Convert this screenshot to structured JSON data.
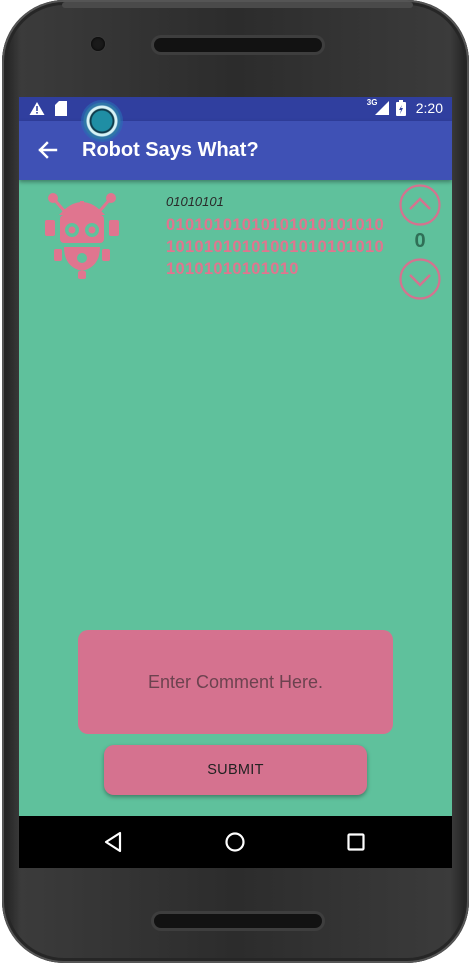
{
  "status_bar": {
    "network_type": "3G",
    "time": "2:20",
    "icons": [
      "warning-icon",
      "sd-card-icon",
      "signal-icon",
      "battery-icon"
    ]
  },
  "app_bar": {
    "title": "Robot Says What?",
    "back_icon": "arrow-left-icon"
  },
  "post": {
    "avatar_icon": "robot-icon",
    "author": "01010101",
    "body": "010101010101010101010101010101010100101010101010101010101010",
    "vote_up_icon": "chevron-up-circle-icon",
    "vote_count": "0",
    "vote_down_icon": "chevron-down-circle-icon"
  },
  "comment": {
    "placeholder": "Enter Comment Here.",
    "value": "",
    "submit_label": "SUBMIT"
  },
  "nav_bar": {
    "icons": [
      "nav-back-icon",
      "nav-home-icon",
      "nav-recents-icon"
    ]
  },
  "colors": {
    "status_bar": "#303f9f",
    "app_bar": "#3f51b5",
    "background": "#5fc19c",
    "accent_pink": "#d5728f",
    "vote_count": "#2f6f56"
  }
}
